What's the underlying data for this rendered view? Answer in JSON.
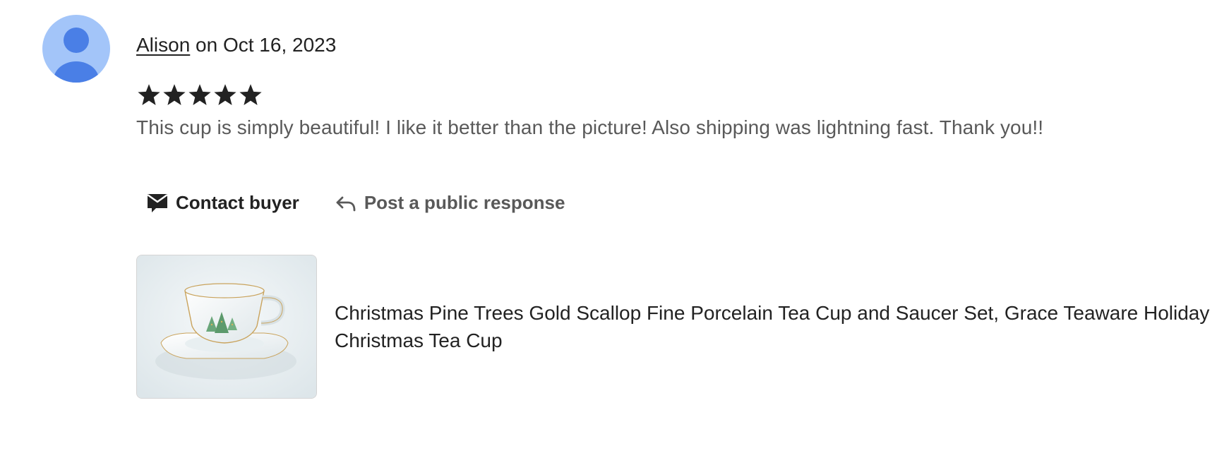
{
  "review": {
    "reviewer_name": "Alison",
    "date_text": " on Oct 16, 2023",
    "rating": 5,
    "rating_max": 5,
    "text": "This cup is simply beautiful! I like it better than the picture! Also shipping was lightning fast. Thank you!!"
  },
  "actions": {
    "contact_label": "Contact buyer",
    "respond_label": "Post a public response"
  },
  "listing": {
    "title": "Christmas Pine Trees Gold Scallop Fine Porcelain Tea Cup and Saucer Set, Grace Teaware Holiday Christmas Tea Cup"
  },
  "icons": {
    "avatar": "default-user-icon",
    "star": "star-icon",
    "contact": "envelope-icon",
    "respond": "reply-arrow-icon"
  },
  "colors": {
    "avatar_bg": "#a3c5f9",
    "avatar_figure": "#4a7fe6",
    "text_primary": "#222222",
    "text_secondary": "#595959",
    "star": "#222222"
  }
}
